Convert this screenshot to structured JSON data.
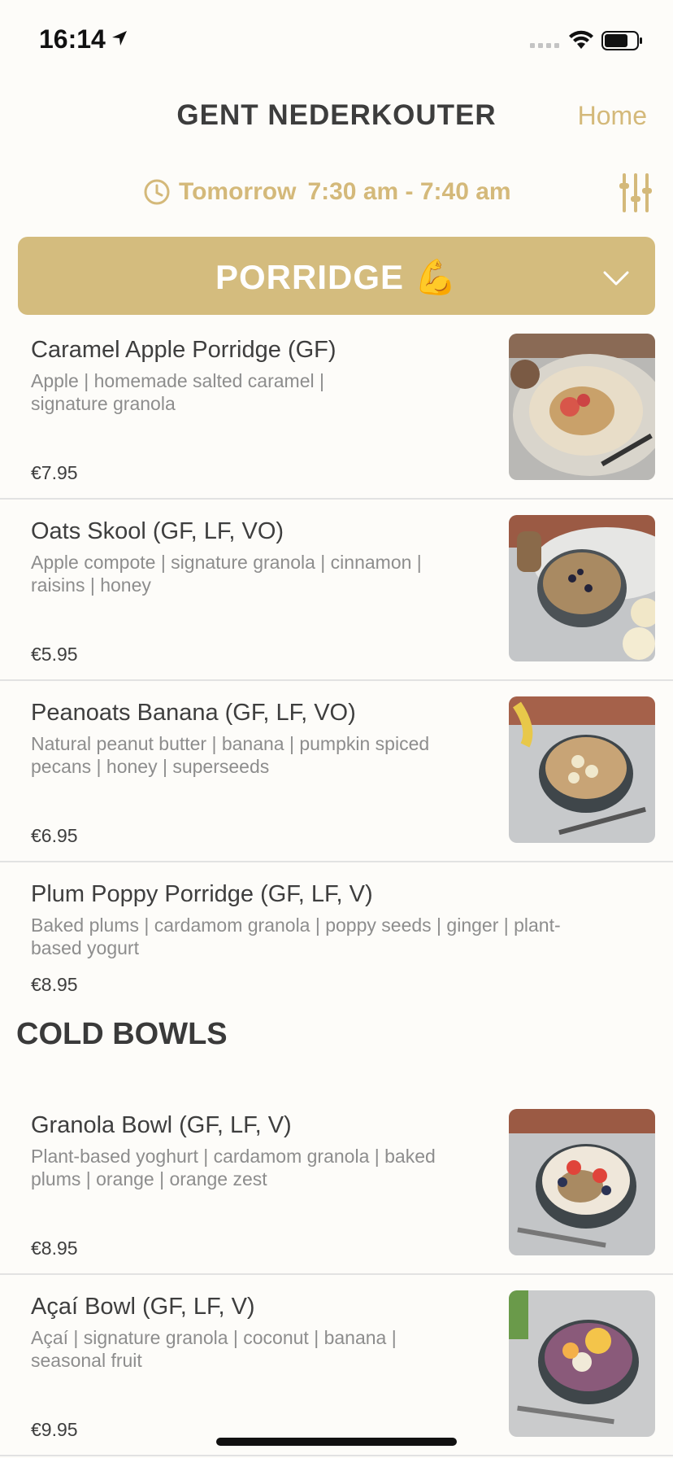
{
  "status": {
    "time": "16:14"
  },
  "header": {
    "title": "GENT NEDERKOUTER",
    "home": "Home"
  },
  "pickup": {
    "day": "Tomorrow",
    "slot": "7:30 am - 7:40 am"
  },
  "category": {
    "label": "PORRIDGE 💪"
  },
  "items": [
    {
      "name": "Caramel Apple Porridge (GF)",
      "desc1": "Apple | homemade salted caramel |",
      "desc2": "signature granola",
      "price": "€7.95"
    },
    {
      "name": "Oats Skool (GF, LF, VO)",
      "desc1": "Apple compote | signature granola | cinnamon |",
      "desc2": "raisins | honey",
      "price": "€5.95"
    },
    {
      "name": "Peanoats Banana (GF, LF, VO)",
      "desc1": "Natural peanut butter | banana | pumpkin spiced",
      "desc2": "pecans | honey | superseeds",
      "price": "€6.95"
    },
    {
      "name": "Plum Poppy Porridge (GF, LF, V)",
      "desc1": "Baked plums | cardamom granola | poppy seeds | ginger | plant-",
      "desc2": "based yogurt",
      "price": "€8.95"
    }
  ],
  "section2": {
    "title": "COLD BOWLS"
  },
  "items2": [
    {
      "name": "Granola Bowl (GF, LF, V)",
      "desc1": "Plant-based yoghurt | cardamom granola | baked",
      "desc2": "plums | orange | orange zest",
      "price": "€8.95"
    },
    {
      "name": "Açaí Bowl (GF, LF, V)",
      "desc1": "Açaí | signature granola | coconut | banana |",
      "desc2": "seasonal fruit",
      "price": "€9.95"
    }
  ],
  "colors": {
    "accent": "#d4b97a",
    "category_bg": "#d4bc7e",
    "text": "#3e3e3e",
    "muted": "#8d8d8d"
  }
}
